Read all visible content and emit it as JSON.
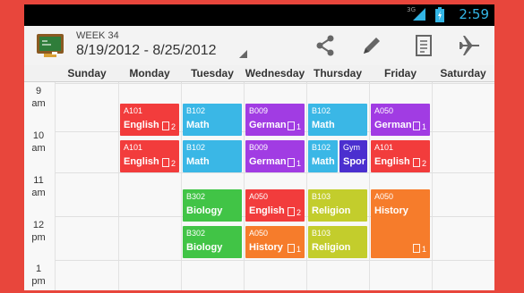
{
  "status_bar": {
    "time": "2:59",
    "network": "3G",
    "accent": "#33b5e5"
  },
  "action_bar": {
    "week_label": "WEEK 34",
    "date_range": "8/19/2012 - 8/25/2012",
    "actions": [
      "share-icon",
      "edit-icon",
      "notes-icon",
      "airplane-icon"
    ]
  },
  "days": [
    "Sunday",
    "Monday",
    "Tuesday",
    "Wednesday",
    "Thursday",
    "Friday",
    "Saturday"
  ],
  "hours": [
    {
      "num": "9",
      "ampm": "am"
    },
    {
      "num": "10",
      "ampm": "am"
    },
    {
      "num": "11",
      "ampm": "am"
    },
    {
      "num": "12",
      "ampm": "pm"
    },
    {
      "num": "1",
      "ampm": "pm"
    }
  ],
  "colors": {
    "red": "#f23c3c",
    "cyan": "#3ab7e6",
    "purple": "#a13ce3",
    "indigo": "#4b2fcf",
    "green": "#41c446",
    "yellow": "#c3cd2c",
    "orange": "#f67c2b"
  },
  "lessons": [
    {
      "room": "A101",
      "subject": "English",
      "count": "2",
      "color": "red"
    },
    {
      "room": "A101",
      "subject": "English",
      "count": "2",
      "color": "red"
    },
    {
      "room": "B102",
      "subject": "Math",
      "count": "",
      "color": "cyan"
    },
    {
      "room": "B102",
      "subject": "Math",
      "count": "",
      "color": "cyan"
    },
    {
      "room": "B302",
      "subject": "Biology",
      "count": "",
      "color": "green"
    },
    {
      "room": "B302",
      "subject": "Biology",
      "count": "",
      "color": "green"
    },
    {
      "room": "B009",
      "subject": "German",
      "count": "1",
      "color": "purple"
    },
    {
      "room": "B009",
      "subject": "German",
      "count": "1",
      "color": "purple"
    },
    {
      "room": "A050",
      "subject": "English",
      "count": "2",
      "color": "red"
    },
    {
      "room": "A050",
      "subject": "History",
      "count": "1",
      "color": "orange"
    },
    {
      "room": "B102",
      "subject": "Math",
      "count": "",
      "color": "cyan"
    },
    {
      "room": "B102",
      "subject": "Math",
      "count": "",
      "color": "cyan"
    },
    {
      "room": "Gym",
      "subject": "Spor",
      "count": "",
      "color": "indigo"
    },
    {
      "room": "B103",
      "subject": "Religion",
      "count": "",
      "color": "yellow"
    },
    {
      "room": "B103",
      "subject": "Religion",
      "count": "",
      "color": "yellow"
    },
    {
      "room": "A050",
      "subject": "German",
      "count": "1",
      "color": "purple"
    },
    {
      "room": "A101",
      "subject": "English",
      "count": "2",
      "color": "red"
    },
    {
      "room": "A050",
      "subject": "History",
      "count": "1",
      "color": "orange"
    }
  ]
}
